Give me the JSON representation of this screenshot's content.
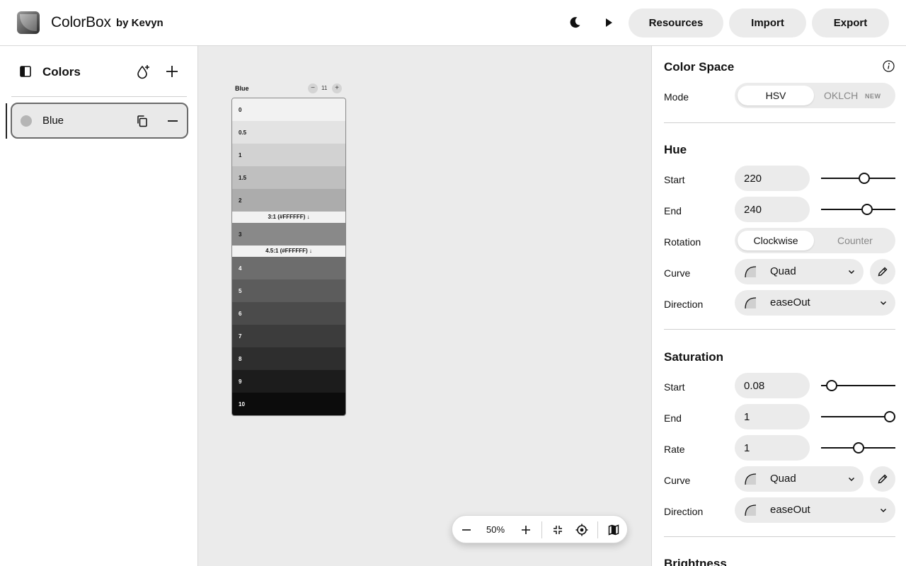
{
  "header": {
    "app_title": "ColorBox",
    "by_line": "by Kevyn",
    "buttons": {
      "resources": "Resources",
      "import": "Import",
      "export": "Export"
    }
  },
  "sidebar": {
    "title": "Colors",
    "items": [
      {
        "name": "Blue"
      }
    ]
  },
  "canvas": {
    "palette": {
      "name": "Blue",
      "step_count": "11",
      "minus": "−",
      "plus": "+",
      "swatches": [
        {
          "label": "0",
          "color": "#f2f2f2",
          "text": "#111111"
        },
        {
          "label": "0.5",
          "color": "#e3e3e3",
          "text": "#111111"
        },
        {
          "label": "1",
          "color": "#d2d2d2",
          "text": "#111111"
        },
        {
          "label": "1.5",
          "color": "#bfbfbf",
          "text": "#111111"
        },
        {
          "label": "2",
          "color": "#acacac",
          "text": "#111111"
        },
        {
          "label": "3",
          "color": "#898989",
          "text": "#111111"
        },
        {
          "label": "4",
          "color": "#6d6d6d",
          "text": "#ffffff"
        },
        {
          "label": "5",
          "color": "#5c5c5c",
          "text": "#ffffff"
        },
        {
          "label": "6",
          "color": "#4b4b4b",
          "text": "#ffffff"
        },
        {
          "label": "7",
          "color": "#3c3c3c",
          "text": "#ffffff"
        },
        {
          "label": "8",
          "color": "#2e2e2e",
          "text": "#ffffff"
        },
        {
          "label": "9",
          "color": "#1c1c1c",
          "text": "#ffffff"
        },
        {
          "label": "10",
          "color": "#0c0c0c",
          "text": "#ffffff"
        }
      ],
      "contrast_markers": [
        "3:1 (#FFFFFF) ↓",
        "4.5:1 (#FFFFFF) ↓"
      ]
    },
    "zoom": {
      "value": "50%"
    }
  },
  "panel": {
    "color_space": {
      "title": "Color Space",
      "mode_label": "Mode",
      "modes": [
        "HSV",
        "OKLCH"
      ],
      "new_badge": "NEW",
      "selected": "HSV"
    },
    "hue": {
      "title": "Hue",
      "start_label": "Start",
      "start_value": "220",
      "start_slider": 0.59,
      "end_label": "End",
      "end_value": "240",
      "end_slider": 0.64,
      "rotation_label": "Rotation",
      "rotation_options": [
        "Clockwise",
        "Counter"
      ],
      "rotation_selected": "Clockwise",
      "curve_label": "Curve",
      "curve_value": "Quad",
      "direction_label": "Direction",
      "direction_value": "easeOut"
    },
    "saturation": {
      "title": "Saturation",
      "start_label": "Start",
      "start_value": "0.08",
      "start_slider": 0.08,
      "end_label": "End",
      "end_value": "1",
      "end_slider": 1.0,
      "rate_label": "Rate",
      "rate_value": "1",
      "rate_slider": 0.5,
      "curve_label": "Curve",
      "curve_value": "Quad",
      "direction_label": "Direction",
      "direction_value": "easeOut"
    },
    "brightness": {
      "title": "Brightness"
    }
  }
}
